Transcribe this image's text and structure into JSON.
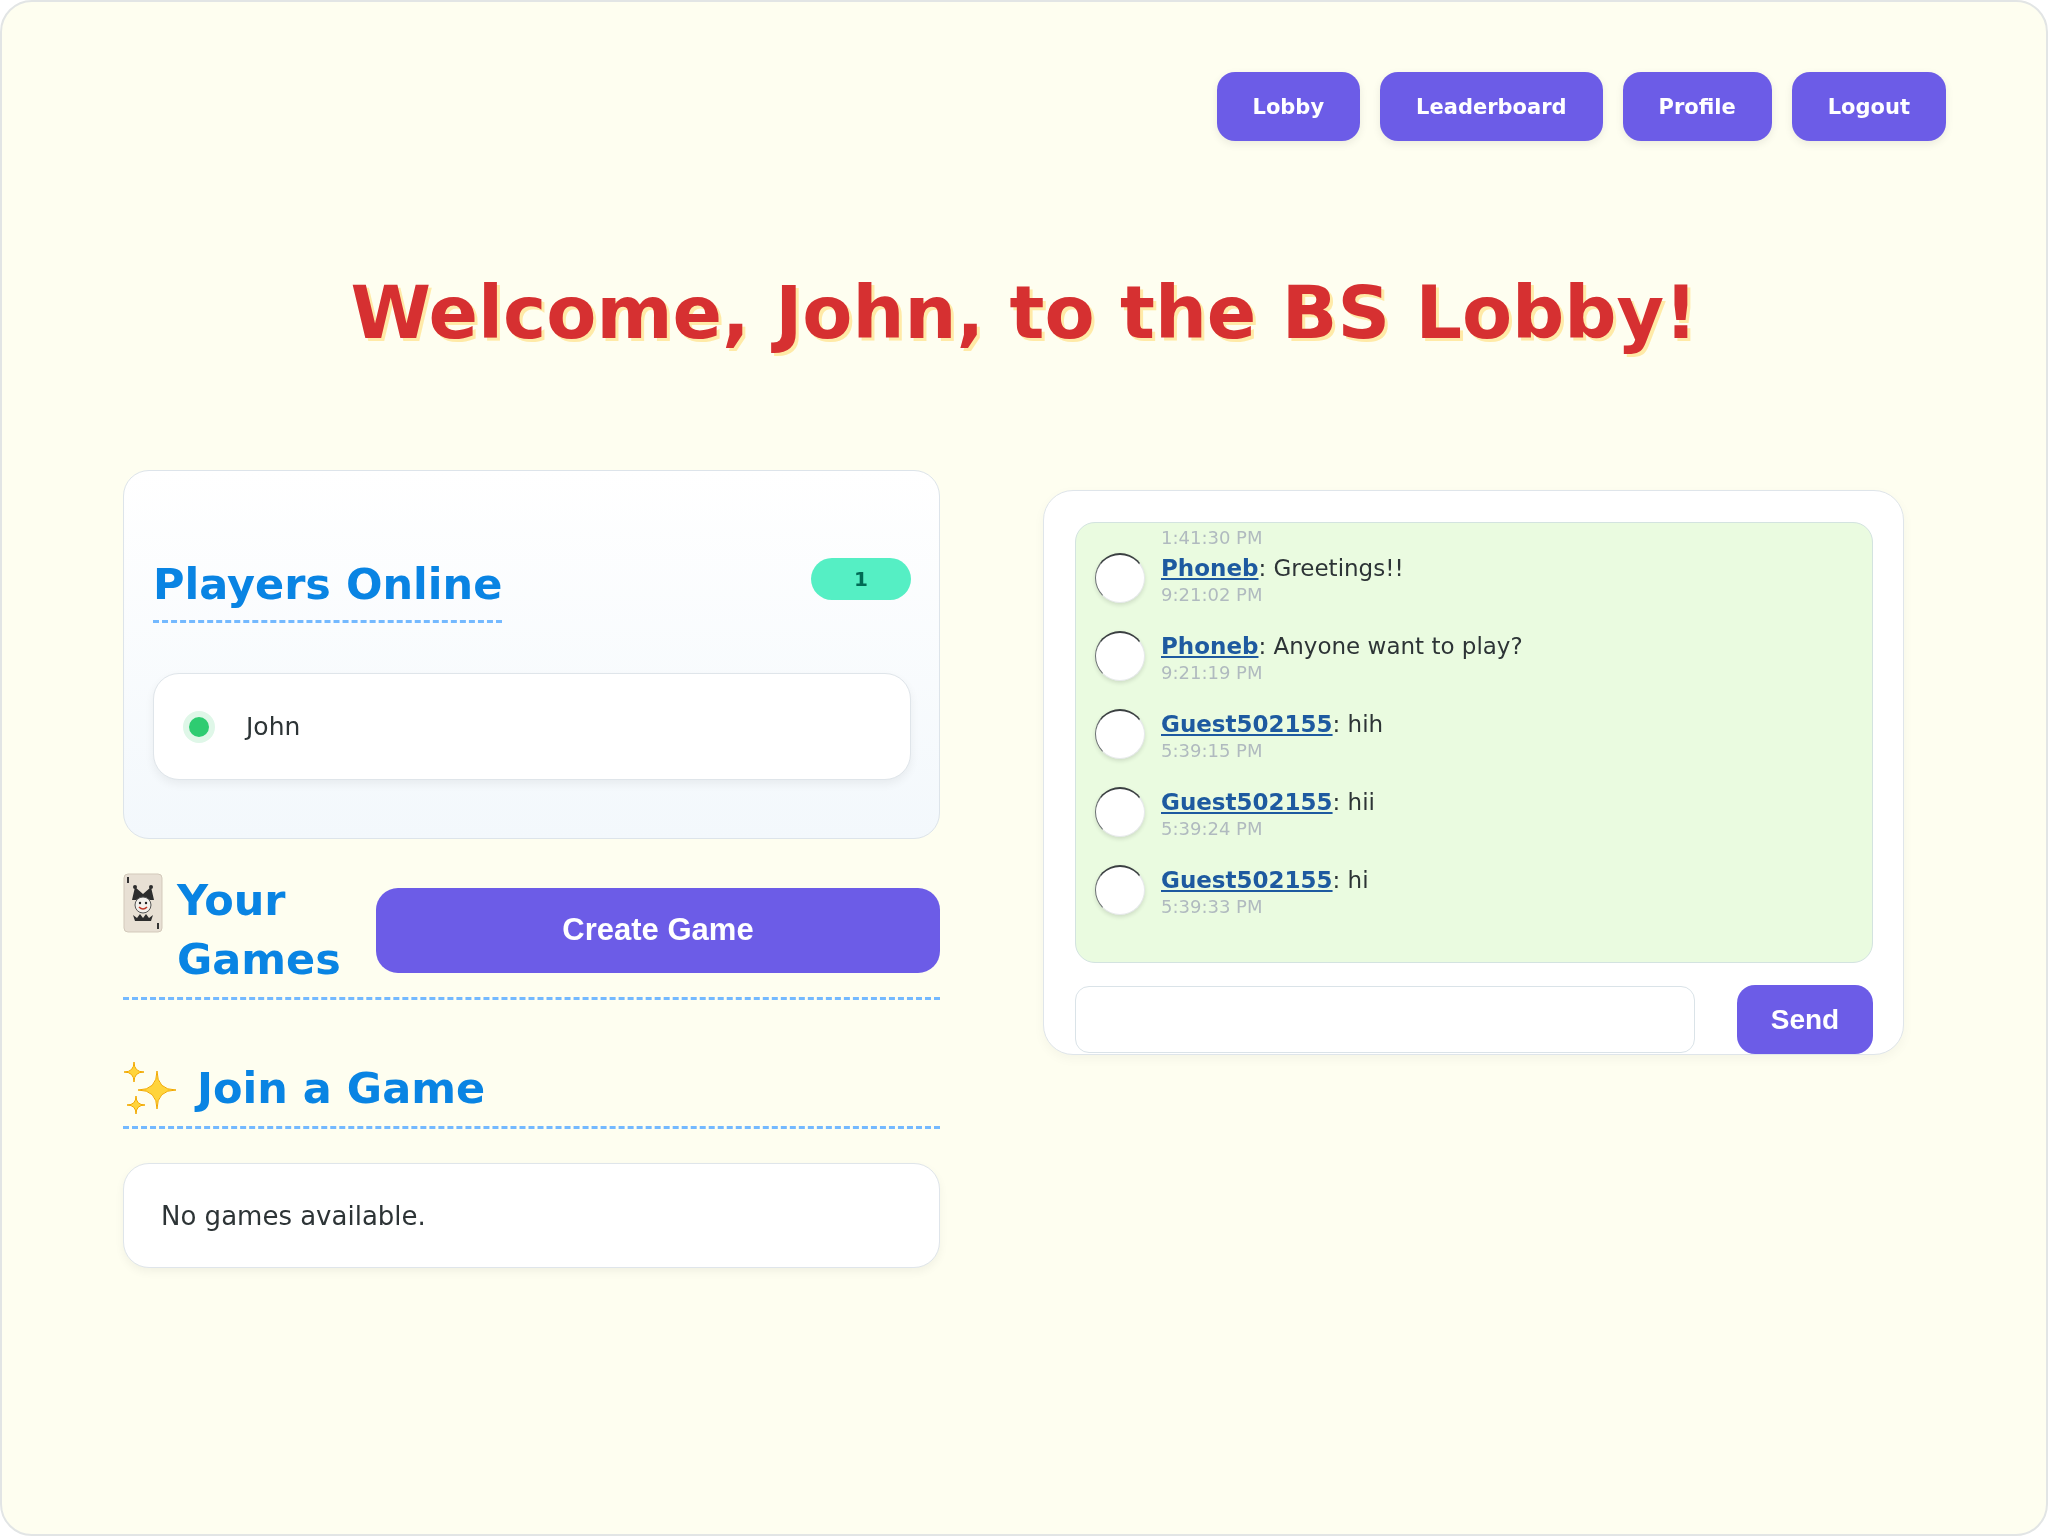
{
  "nav": {
    "buttons": [
      {
        "label": "Lobby"
      },
      {
        "label": "Leaderboard"
      },
      {
        "label": "Profile"
      },
      {
        "label": "Logout"
      }
    ]
  },
  "title": "Welcome, John, to the BS Lobby!",
  "players_online": {
    "title": "Players Online",
    "count": "1",
    "players": [
      {
        "name": "John",
        "online": true
      }
    ]
  },
  "your_games": {
    "title": "Your Games",
    "create_button": "Create Game"
  },
  "join_game": {
    "title": "Join a Game",
    "empty_message": "No games available."
  },
  "chat": {
    "messages": [
      {
        "time": "1:41:30 PM"
      },
      {
        "user": "Phoneb",
        "text": ": Greetings!!",
        "time": "9:21:02 PM"
      },
      {
        "user": "Phoneb",
        "text": ": Anyone want to play?",
        "time": "9:21:19 PM"
      },
      {
        "user": "Guest502155",
        "text": ": hih",
        "time": "5:39:15 PM"
      },
      {
        "user": "Guest502155",
        "text": ": hii",
        "time": "5:39:24 PM"
      },
      {
        "user": "Guest502155",
        "text": ": hi",
        "time": "5:39:33 PM"
      }
    ],
    "send_button": "Send"
  }
}
